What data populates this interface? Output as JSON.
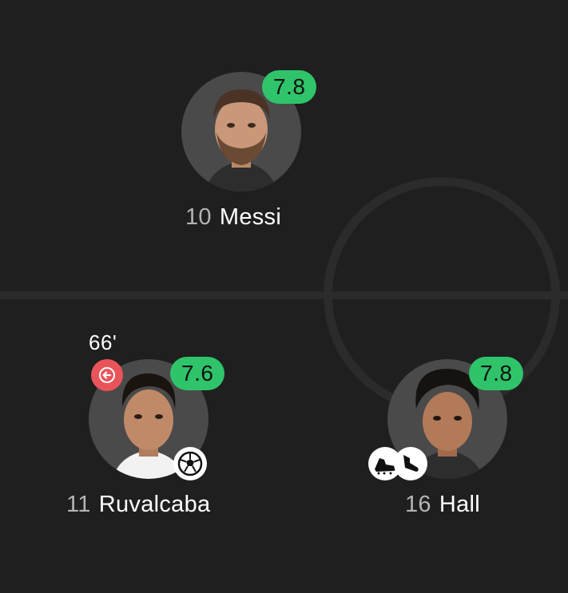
{
  "players": [
    {
      "number": "10",
      "name": "Messi",
      "rating": "7.8",
      "photo_icon": "player-photo-messi"
    },
    {
      "number": "11",
      "name": "Ruvalcaba",
      "rating": "7.6",
      "sub_minute": "66'",
      "substitution_icon": "sub-out-arrow-icon",
      "event_icon": "goal-ball-icon",
      "photo_icon": "player-photo-ruvalcaba"
    },
    {
      "number": "16",
      "name": "Hall",
      "rating": "7.8",
      "event_icon": "assist-boots-icon",
      "photo_icon": "player-photo-hall"
    }
  ],
  "colors": {
    "background": "#1f1f1f",
    "pitch_lines": "#2b2b2b",
    "rating_green": "#2fc46a",
    "sub_red": "#e9545a"
  }
}
